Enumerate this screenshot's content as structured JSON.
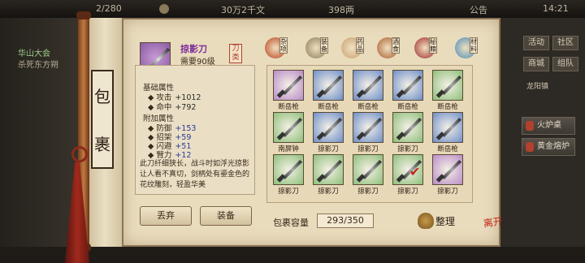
{
  "topbar": {
    "stat1": "2/280",
    "stat2": "30万2千文",
    "stat3": "398两",
    "notice": "公告",
    "clock": "14:21"
  },
  "quest": {
    "line1": "华山大会",
    "line2": "杀死东方朔"
  },
  "right_side": {
    "buttons": [
      "活动",
      "社区",
      "商城",
      "组队"
    ],
    "label": "龙阳镇",
    "fire_stove": "火炉桌",
    "gold_stove": "黄金熔炉"
  },
  "bag_title": [
    "包",
    "裹"
  ],
  "item": {
    "name": "掠影刀",
    "requirement": "需要90级",
    "type": "刀类",
    "base_title": "基础属性",
    "base_attrs": [
      {
        "label": "攻击",
        "value": "+1012"
      },
      {
        "label": "命中",
        "value": "+792"
      }
    ],
    "extra_title": "附加属性",
    "extra_attrs": [
      {
        "label": "防御",
        "value": "+153"
      },
      {
        "label": "招架",
        "value": "+59"
      },
      {
        "label": "闪避",
        "value": "+51"
      },
      {
        "label": "臂力",
        "value": "+12"
      }
    ],
    "description": "此刀纤细狭长，战斗时如浮光掠影让人看不真切，剑柄处有鎏金色的花纹雕刻，轻盈华美",
    "discard_label": "丢弃",
    "equip_label": "装备"
  },
  "tabs": [
    {
      "label": "杂项",
      "color": "#b8421e"
    },
    {
      "label": "装备",
      "color": "#8a7a5a"
    },
    {
      "label": "药品",
      "color": "#c8a070"
    },
    {
      "label": "酒食",
      "color": "#a85a2a"
    },
    {
      "label": "秘籍",
      "color": "#a02a2a"
    },
    {
      "label": "材料",
      "color": "#4a8ab8"
    }
  ],
  "grid": [
    {
      "label": "断岳枪",
      "bg": "#b98cc8"
    },
    {
      "label": "断岳枪",
      "bg": "#6f8fc8"
    },
    {
      "label": "断岳枪",
      "bg": "#6f8fc8"
    },
    {
      "label": "断岳枪",
      "bg": "#6f8fc8"
    },
    {
      "label": "断岳枪",
      "bg": "#8fbf7a"
    },
    {
      "label": "南屏钟",
      "bg": "#8fbf7a"
    },
    {
      "label": "掠影刀",
      "bg": "#6f8fc8"
    },
    {
      "label": "掠影刀",
      "bg": "#6f8fc8"
    },
    {
      "label": "掠影刀",
      "bg": "#8fbf7a"
    },
    {
      "label": "断岳枪",
      "bg": "#6f8fc8"
    },
    {
      "label": "掠影刀",
      "bg": "#8fbf7a"
    },
    {
      "label": "掠影刀",
      "bg": "#8fbf7a"
    },
    {
      "label": "掠影刀",
      "bg": "#8fbf7a"
    },
    {
      "label": "掠影刀",
      "bg": "#8fbf7a"
    },
    {
      "label": "掠影刀",
      "bg": "#b98cc8"
    }
  ],
  "capacity_label": "包裹容量",
  "capacity_value": "293/350",
  "sort_label": "整理",
  "seal_text": "离开"
}
